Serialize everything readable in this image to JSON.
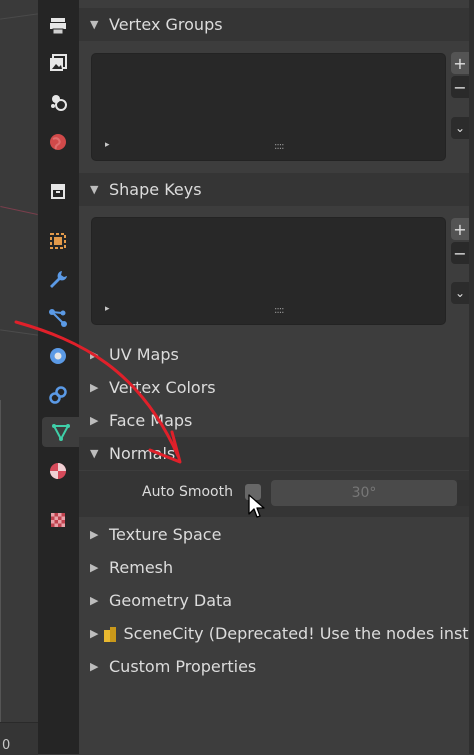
{
  "viewport": {
    "corner_value": "0"
  },
  "tabs": [
    {
      "icon": "printer-icon",
      "active": false
    },
    {
      "icon": "image-icon",
      "active": false
    },
    {
      "icon": "scene-icon",
      "active": false
    },
    {
      "icon": "world-icon",
      "active": false
    },
    {
      "icon": "collection-icon",
      "active": false
    },
    {
      "icon": "object-icon",
      "active": false
    },
    {
      "icon": "wrench-icon",
      "active": false
    },
    {
      "icon": "particles-icon",
      "active": false
    },
    {
      "icon": "physics-icon",
      "active": false
    },
    {
      "icon": "constraints-icon",
      "active": false
    },
    {
      "icon": "mesh-data-icon",
      "active": true
    },
    {
      "icon": "material-icon",
      "active": false
    },
    {
      "icon": "texture-icon",
      "active": false
    }
  ],
  "panels": {
    "vertex_groups": "Vertex Groups",
    "shape_keys": "Shape Keys",
    "uv_maps": "UV Maps",
    "vertex_colors": "Vertex Colors",
    "face_maps": "Face Maps",
    "normals": "Normals",
    "texture_space": "Texture Space",
    "remesh": "Remesh",
    "geometry_data": "Geometry Data",
    "scenecity": "SceneCity (Deprecated! Use the nodes inste",
    "custom_properties": "Custom Properties"
  },
  "normals": {
    "auto_smooth_label": "Auto Smooth",
    "auto_smooth_checked": false,
    "angle_value": "30°"
  },
  "list": {
    "play_glyph": "▸",
    "grip_glyph": "::::",
    "add_glyph": "+",
    "remove_glyph": "−",
    "menu_glyph": "⌄"
  },
  "colors": {
    "annotation_arrow": "#e0202a",
    "addon_icon": "#e8b830"
  }
}
